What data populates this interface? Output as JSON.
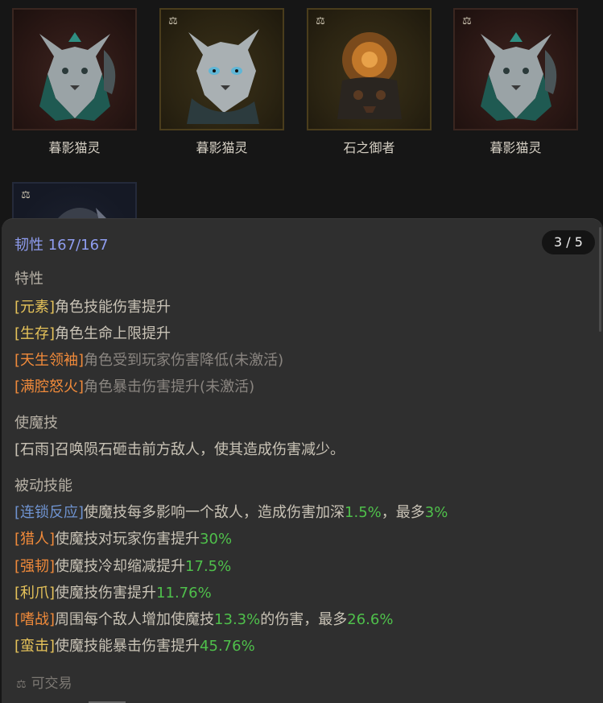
{
  "cards": [
    {
      "name": "暮影猫灵",
      "tradeable": false,
      "frame": "red"
    },
    {
      "name": "暮影猫灵",
      "tradeable": true,
      "frame": "gold"
    },
    {
      "name": "石之御者",
      "tradeable": true,
      "frame": "gold"
    },
    {
      "name": "暮影猫灵",
      "tradeable": true,
      "frame": "red"
    },
    {
      "name": "",
      "tradeable": true,
      "frame": "blue"
    }
  ],
  "tooltip": {
    "toughness_label": "韧性",
    "toughness_value": "167/167",
    "pager": "3 / 5",
    "traits_heading": "特性",
    "traits": [
      {
        "tag": "[元素]",
        "text": "角色技能伤害提升",
        "tag_color": "gold",
        "active": true
      },
      {
        "tag": "[生存]",
        "text": "角色生命上限提升",
        "tag_color": "gold",
        "active": true
      },
      {
        "tag": "[天生领袖]",
        "text": "角色受到玩家伤害降低(未激活)",
        "tag_color": "orange",
        "active": false
      },
      {
        "tag": "[满腔怒火]",
        "text": "角色暴击伤害提升(未激活)",
        "tag_color": "orange",
        "active": false
      }
    ],
    "skill_heading": "使魔技",
    "skill_text": "[石雨]召唤陨石砸击前方敌人，使其造成伤害减少。",
    "passive_heading": "被动技能",
    "passives": [
      {
        "tag": "[连锁反应]",
        "tag_color": "blue",
        "parts": [
          "使魔技每多影响一个敌人，造成伤害加深",
          "1.5%",
          "，最多",
          "3%"
        ]
      },
      {
        "tag": "[猎人]",
        "tag_color": "orange",
        "parts": [
          "使魔技对玩家伤害提升",
          "30%"
        ]
      },
      {
        "tag": "[强韧]",
        "tag_color": "orange",
        "parts": [
          "使魔技冷却缩减提升",
          "17.5%"
        ]
      },
      {
        "tag": "[利爪]",
        "tag_color": "gold",
        "parts": [
          "使魔技伤害提升",
          "11.76%"
        ]
      },
      {
        "tag": "[嗜战]",
        "tag_color": "orange",
        "parts": [
          "周围每个敌人增加使魔技",
          "13.3%",
          "的伤害，最多",
          "26.6%"
        ]
      },
      {
        "tag": "[蛮击]",
        "tag_color": "gold",
        "parts": [
          "使魔技能暴击伤害提升",
          "45.76%"
        ]
      }
    ],
    "footer": "可交易",
    "footer_icon": "trade-scale-icon"
  },
  "colors": {
    "gold": "#e6c35a",
    "orange": "#f08a3a",
    "blue": "#6f93d0",
    "green": "#4fc04b",
    "toughness": "#8f9df0"
  }
}
